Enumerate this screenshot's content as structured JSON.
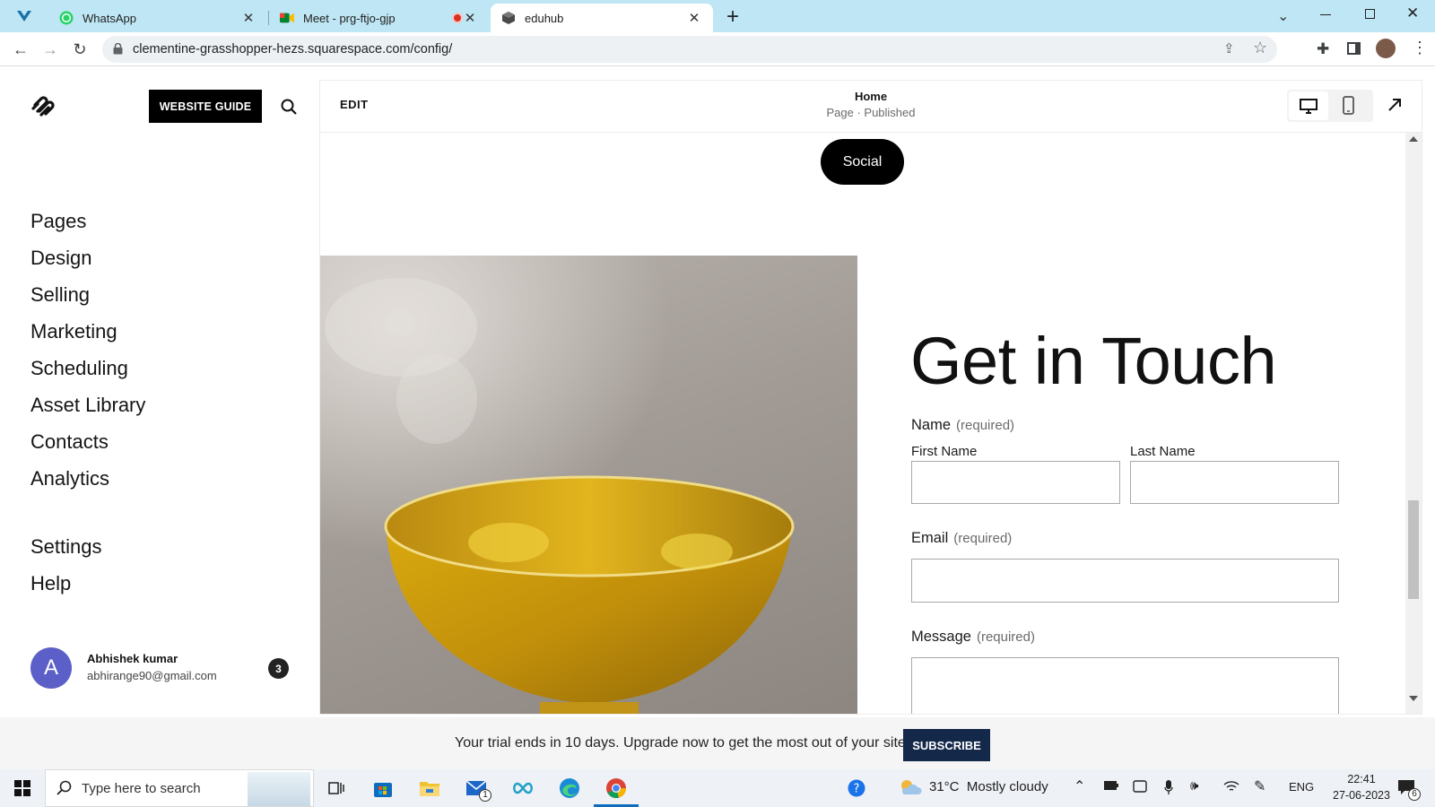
{
  "browser": {
    "tabs": [
      {
        "label": "WhatsApp",
        "icon": "whatsapp-icon"
      },
      {
        "label": "Meet - prg-ftjo-gjp",
        "icon": "google-meet-icon"
      },
      {
        "label": "eduhub",
        "icon": "squarespace-tab-icon"
      }
    ],
    "new_tab": "+",
    "url": "clementine-grasshopper-hezs.squarespace.com/config/"
  },
  "sidebar": {
    "guide_label": "WEBSITE GUIDE",
    "nav": [
      "Pages",
      "Design",
      "Selling",
      "Marketing",
      "Scheduling",
      "Asset Library",
      "Contacts",
      "Analytics"
    ],
    "nav2": [
      "Settings",
      "Help"
    ],
    "user": {
      "initial": "A",
      "name": "Abhishek kumar",
      "email": "abhirange90@gmail.com",
      "badge": "3"
    }
  },
  "editor": {
    "edit_label": "EDIT",
    "page_title": "Home",
    "page_status": "Page · Published",
    "social_button": "Social",
    "heading": "Get in Touch",
    "form": {
      "name_label": "Name",
      "required": "(required)",
      "first_name": "First Name",
      "last_name": "Last Name",
      "email_label": "Email",
      "message_label": "Message"
    }
  },
  "banner": {
    "text": "Your trial ends in 10 days. Upgrade now to get the most out of your site.",
    "subscribe": "SUBSCRIBE"
  },
  "taskbar": {
    "search_placeholder": "Type here to search",
    "mail_badge": "1",
    "weather": "31°C  Mostly cloudy",
    "lang": "ENG",
    "time": "22:41",
    "date": "27-06-2023",
    "notif_badge": "6"
  },
  "colors": {
    "tab_strip": "#bfe6f4",
    "subscribe_bg": "#14284a",
    "avatar": "#5b5fc7"
  }
}
